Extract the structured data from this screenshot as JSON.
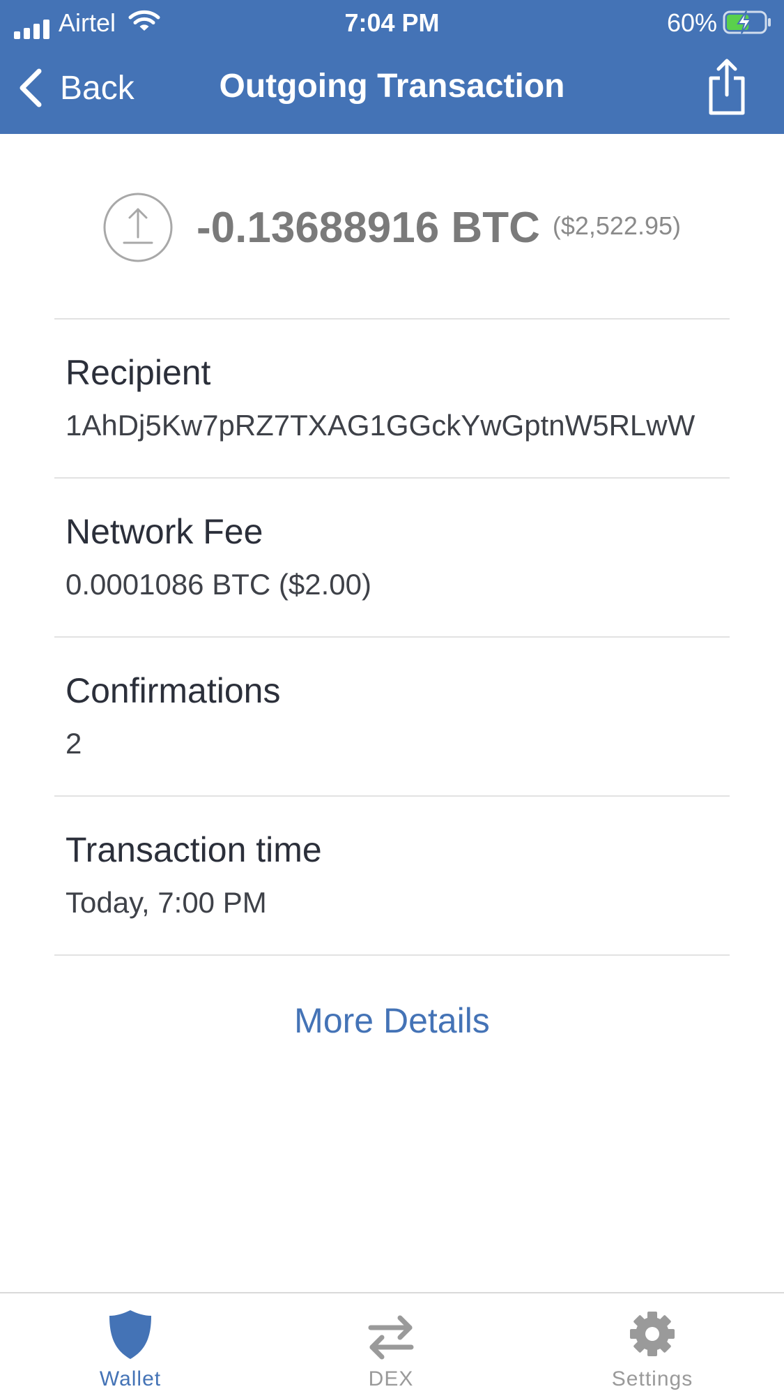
{
  "status_bar": {
    "carrier": "Airtel",
    "time": "7:04 PM",
    "battery_percent": "60%",
    "battery_level": 0.6,
    "charging": true,
    "signal_bars": 4
  },
  "nav": {
    "back_label": "Back",
    "title": "Outgoing Transaction",
    "share_icon": "share-icon"
  },
  "transaction": {
    "direction_icon": "outgoing-arrow-icon",
    "amount": "-0.13688916 BTC",
    "amount_fiat": "($2,522.95)"
  },
  "details": [
    {
      "label": "Recipient",
      "value": "1AhDj5Kw7pRZ7TXAG1GGckYwGptnW5RLwW"
    },
    {
      "label": "Network Fee",
      "value": "0.0001086 BTC ($2.00)"
    },
    {
      "label": "Confirmations",
      "value": "2"
    },
    {
      "label": "Transaction time",
      "value": "Today, 7:00 PM"
    }
  ],
  "more_details_label": "More Details",
  "tabs": [
    {
      "label": "Wallet",
      "icon": "shield-icon",
      "active": true
    },
    {
      "label": "DEX",
      "icon": "swap-arrows-icon",
      "active": false
    },
    {
      "label": "Settings",
      "icon": "gear-icon",
      "active": false
    }
  ],
  "colors": {
    "brand": "#4473b6",
    "amount": "#7a7a7a",
    "inactive_tab": "#9a9a9a",
    "battery_fill": "#5ad04c"
  }
}
